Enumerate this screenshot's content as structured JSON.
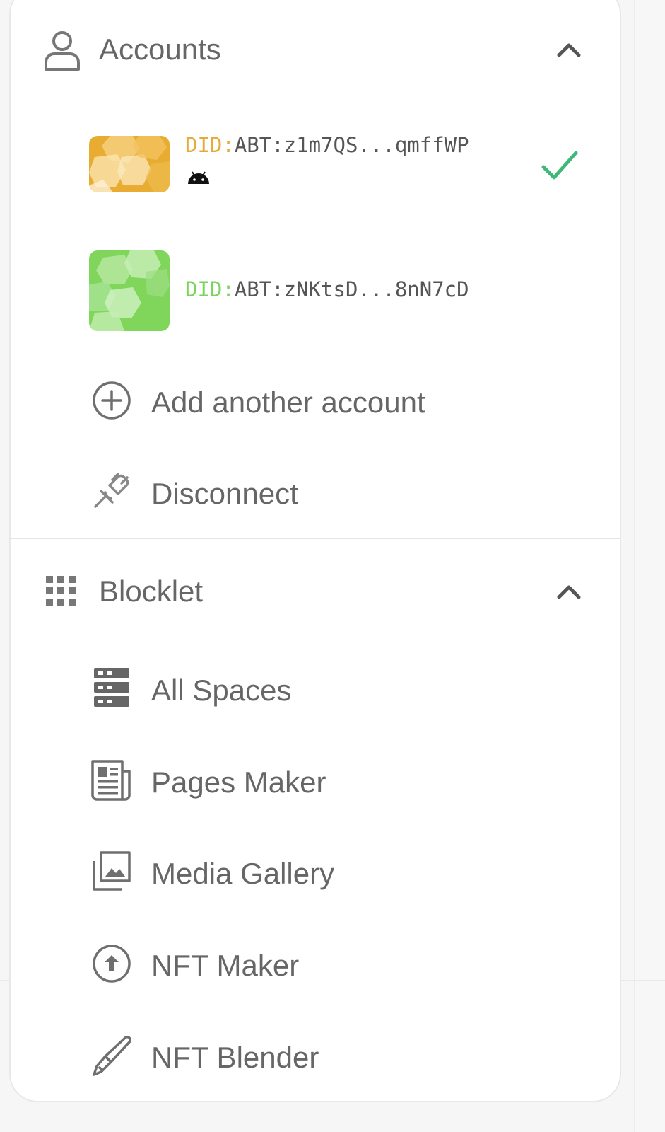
{
  "accounts_section": {
    "title": "Accounts",
    "icon": "user-icon",
    "expanded": true,
    "accounts": [
      {
        "did_prefix": "DID:",
        "did_rest": "ABT:z1m7QS...qmffWP",
        "prefix_color": "#e7a93a",
        "avatar_color": "#e9ac33",
        "platform_icon": "android-icon",
        "selected": true
      },
      {
        "did_prefix": "DID:",
        "did_rest": "ABT:zNKtsD...8nN7cD",
        "prefix_color": "#79d45a",
        "avatar_color": "#7fd65a",
        "selected": false
      }
    ],
    "actions": [
      {
        "label": "Add another account",
        "icon": "add-circle-icon"
      },
      {
        "label": "Disconnect",
        "icon": "plug-icon"
      }
    ]
  },
  "blocklet_section": {
    "title": "Blocklet",
    "icon": "apps-grid-icon",
    "expanded": true,
    "items": [
      {
        "label": "All Spaces",
        "icon": "storage-icon"
      },
      {
        "label": "Pages Maker",
        "icon": "newspaper-icon"
      },
      {
        "label": "Media Gallery",
        "icon": "photo-library-icon"
      },
      {
        "label": "NFT Maker",
        "icon": "upload-circle-icon"
      },
      {
        "label": "NFT Blender",
        "icon": "brush-icon"
      }
    ]
  },
  "colors": {
    "check": "#3fb97a",
    "text": "#666666",
    "icon": "#6f6f6f"
  }
}
